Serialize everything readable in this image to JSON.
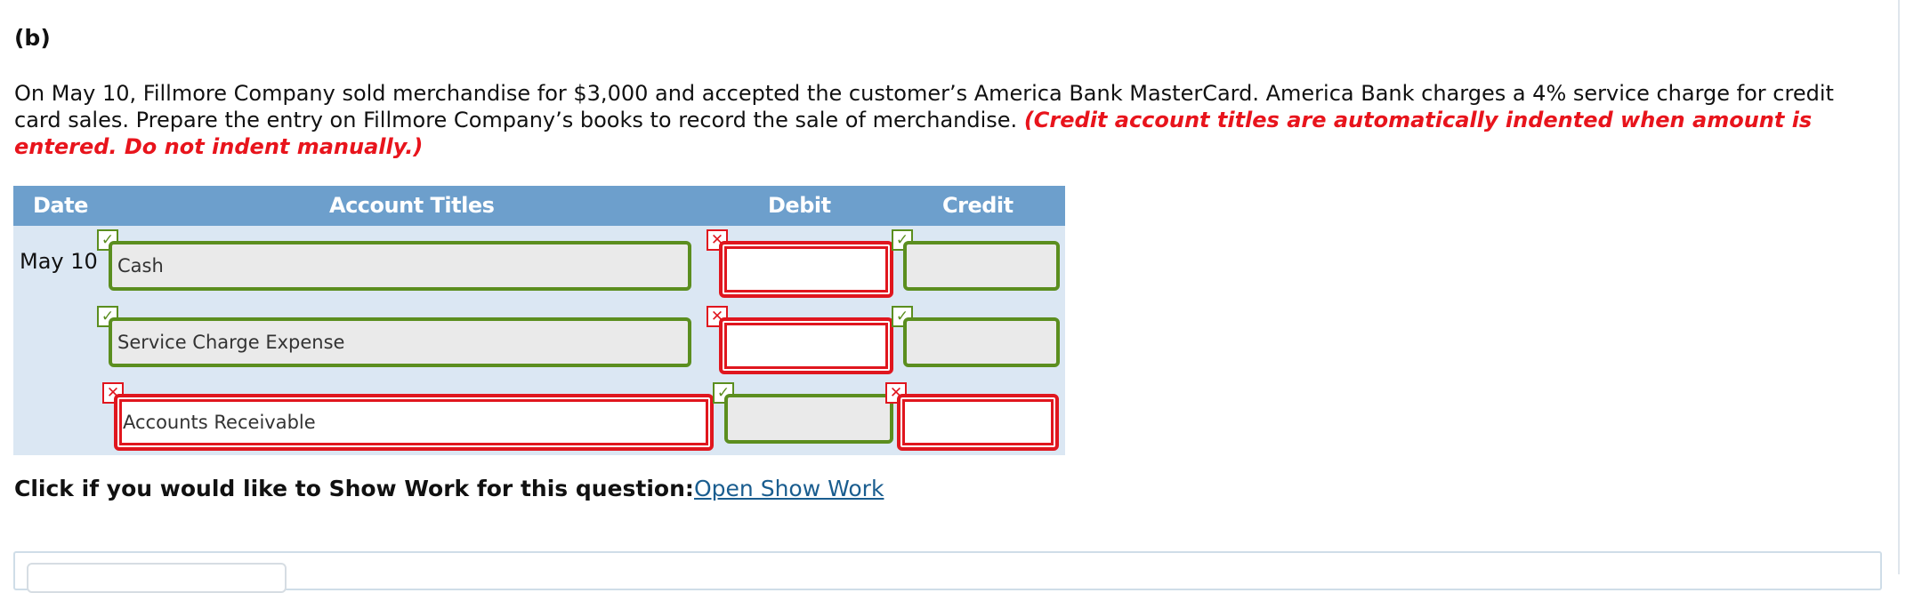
{
  "part_label": "(b)",
  "question": {
    "text": "On May 10, Fillmore Company sold merchandise for $3,000 and accepted the customer’s America Bank MasterCard. America Bank charges a 4% service charge for credit card sales. Prepare the entry on Fillmore Company’s books to record the sale of merchandise. ",
    "note": "(Credit account titles are automatically indented when amount is entered. Do not indent manually.)"
  },
  "journal": {
    "headers": {
      "date": "Date",
      "account": "Account Titles",
      "debit": "Debit",
      "credit": "Credit"
    },
    "rows": [
      {
        "date": "May 10",
        "account": "Cash",
        "account_status": "correct",
        "debit": "",
        "debit_status": "incorrect",
        "credit": "",
        "credit_status": "correct"
      },
      {
        "date": "",
        "account": "Service Charge Expense",
        "account_status": "correct",
        "debit": "",
        "debit_status": "incorrect",
        "credit": "",
        "credit_status": "correct"
      },
      {
        "date": "",
        "account": "Accounts Receivable",
        "account_status": "incorrect",
        "debit": "",
        "debit_status": "correct",
        "credit": "",
        "credit_status": "incorrect"
      }
    ]
  },
  "show_work": {
    "prompt": "Click if you would like to Show Work for this question:",
    "link": "Open Show Work"
  },
  "colors": {
    "header": "#6d9fcc",
    "table_bg": "#dbe7f3",
    "correct": "#5b8e1f",
    "incorrect": "#e0161e",
    "note": "#e8141c",
    "link": "#1a5d8f"
  },
  "icons": {
    "correct": "check-icon",
    "incorrect": "x-icon"
  }
}
